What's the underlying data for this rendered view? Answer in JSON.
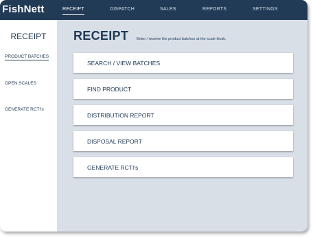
{
  "app": {
    "logo": "FishNett"
  },
  "nav": {
    "items": [
      {
        "label": "RECEIPT",
        "active": true
      },
      {
        "label": "DISPATCH"
      },
      {
        "label": "SALES"
      },
      {
        "label": "REPORTS"
      },
      {
        "label": "SETTINGS"
      }
    ]
  },
  "sidebar": {
    "title": "RECEIPT",
    "items": [
      {
        "label": "PRODUCT BATCHES",
        "active": true
      },
      {
        "label": "OPEN SCALES"
      },
      {
        "label": "GENERATE RCTI's"
      }
    ]
  },
  "main": {
    "title": "RECEIPT",
    "subtitle": "Enter / receive the product batches at the scale kiosk.",
    "actions": [
      {
        "label": "SEARCH / VIEW BATCHES"
      },
      {
        "label": "FIND PRODUCT"
      },
      {
        "label": "DISTRIBUTION REPORT"
      },
      {
        "label": "DISPOSAL REPORT"
      },
      {
        "label": "GENERATE RCTI's"
      }
    ]
  },
  "colors": {
    "navy": "#213a56",
    "content_bg": "#d9dfe7",
    "card_bg": "#ffffff"
  }
}
